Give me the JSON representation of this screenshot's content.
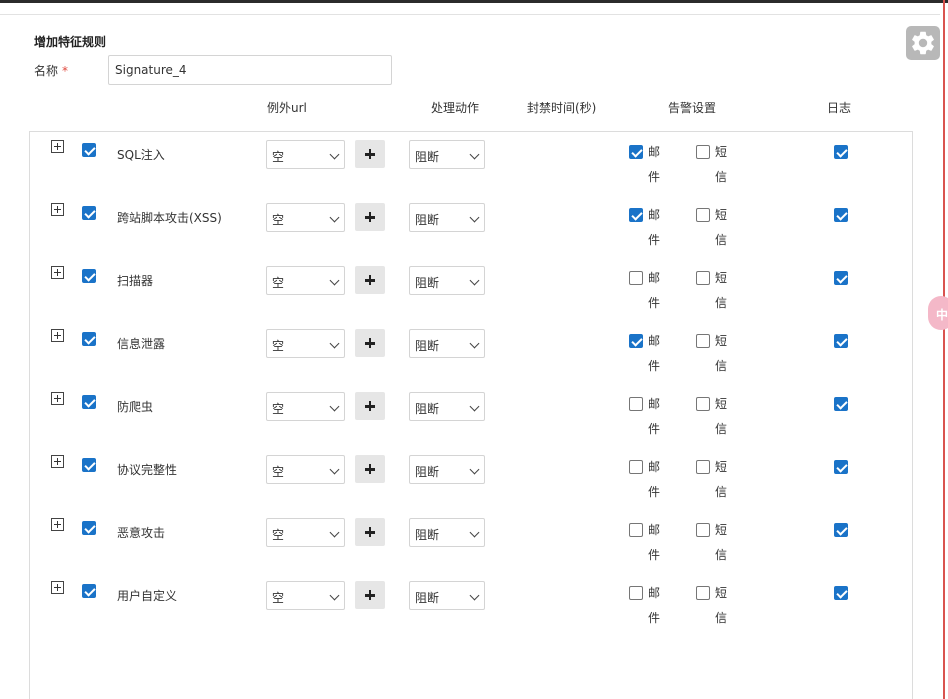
{
  "form": {
    "title": "增加特征规则",
    "name_label": "名称",
    "required_mark": "*",
    "name_value": "Signature_4"
  },
  "columns": {
    "exception_url": "例外url",
    "action": "处理动作",
    "ban_time": "封禁时间(秒)",
    "alarm": "告警设置",
    "log": "日志"
  },
  "alarm_labels": {
    "email_1": "邮",
    "email_2": "件",
    "sms_1": "短",
    "sms_2": "信"
  },
  "side_tab": "中",
  "rules": [
    {
      "name": "SQL注入",
      "enabled": true,
      "url": "空",
      "action": "阻断",
      "email": true,
      "sms": false,
      "log": true
    },
    {
      "name": "跨站脚本攻击(XSS)",
      "enabled": true,
      "url": "空",
      "action": "阻断",
      "email": true,
      "sms": false,
      "log": true
    },
    {
      "name": "扫描器",
      "enabled": true,
      "url": "空",
      "action": "阻断",
      "email": false,
      "sms": false,
      "log": true
    },
    {
      "name": "信息泄露",
      "enabled": true,
      "url": "空",
      "action": "阻断",
      "email": true,
      "sms": false,
      "log": true
    },
    {
      "name": "防爬虫",
      "enabled": true,
      "url": "空",
      "action": "阻断",
      "email": false,
      "sms": false,
      "log": true
    },
    {
      "name": "协议完整性",
      "enabled": true,
      "url": "空",
      "action": "阻断",
      "email": false,
      "sms": false,
      "log": true
    },
    {
      "name": "恶意攻击",
      "enabled": true,
      "url": "空",
      "action": "阻断",
      "email": false,
      "sms": false,
      "log": true
    },
    {
      "name": "用户自定义",
      "enabled": true,
      "url": "空",
      "action": "阻断",
      "email": false,
      "sms": false,
      "log": true
    }
  ],
  "colors": {
    "checkbox_checked": "#1a73c8",
    "required": "#e04a3f",
    "settings_button": "#b8b8b8"
  },
  "icons": [
    "gear-icon",
    "expand-plus-icon",
    "add-icon",
    "chevron-down-icon"
  ]
}
